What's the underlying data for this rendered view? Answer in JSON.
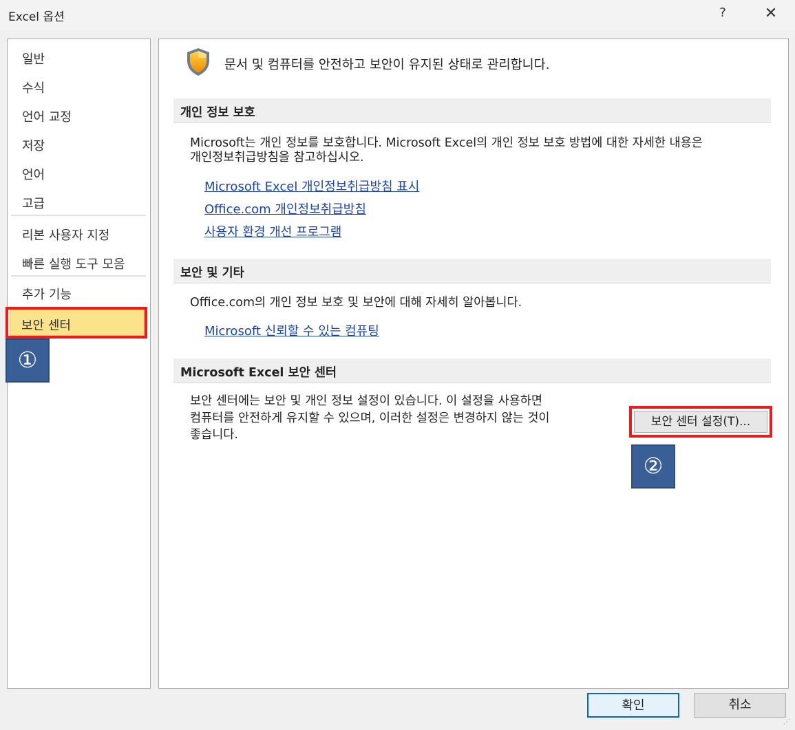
{
  "window": {
    "title": "Excel 옵션",
    "help_label": "?",
    "close_label": "✕"
  },
  "nav": {
    "items": [
      {
        "label": "일반"
      },
      {
        "label": "수식"
      },
      {
        "label": "언어 교정"
      },
      {
        "label": "저장"
      },
      {
        "label": "언어"
      },
      {
        "label": "고급"
      },
      {
        "label": "리본 사용자 지정"
      },
      {
        "label": "빠른 실행 도구 모음"
      },
      {
        "label": "추가 기능"
      },
      {
        "label": "보안 센터"
      }
    ],
    "selected": "보안 센터"
  },
  "annotations": {
    "badge1": "①",
    "badge2": "②",
    "highlight_color": "#ee1b1b",
    "badge_color": "#3a5f96"
  },
  "content": {
    "header": "문서 및 컴퓨터를 안전하고 보안이 유지된 상태로 관리합니다.",
    "header_icon": "shield-icon",
    "privacy": {
      "title": "개인 정보 보호",
      "text_line1": "Microsoft는 개인 정보를 보호합니다. Microsoft Excel의 개인 정보 보호 방법에 대한 자세한 내용은",
      "text_line2": "개인정보취급방침을 참고하십시오.",
      "links": [
        "Microsoft Excel 개인정보취급방침 표시",
        "Office.com 개인정보취급방침",
        "사용자 환경 개선 프로그램"
      ]
    },
    "security": {
      "title": "보안 및 기타",
      "text": "Office.com의 개인 정보 보호 및 보안에 대해 자세히 알아봅니다.",
      "link": "Microsoft 신뢰할 수 있는 컴퓨팅"
    },
    "trust_center": {
      "title": "Microsoft Excel 보안 센터",
      "text_line1": "보안 센터에는 보안 및 개인 정보 설정이 있습니다. 이 설정을 사용하면",
      "text_line2": "컴퓨터를 안전하게 유지할 수 있으며, 이러한 설정은 변경하지 않는 것이",
      "text_line3": "좋습니다.",
      "button_label": "보안 센터 설정(T)..."
    }
  },
  "footer": {
    "ok_label": "확인",
    "cancel_label": "취소"
  }
}
